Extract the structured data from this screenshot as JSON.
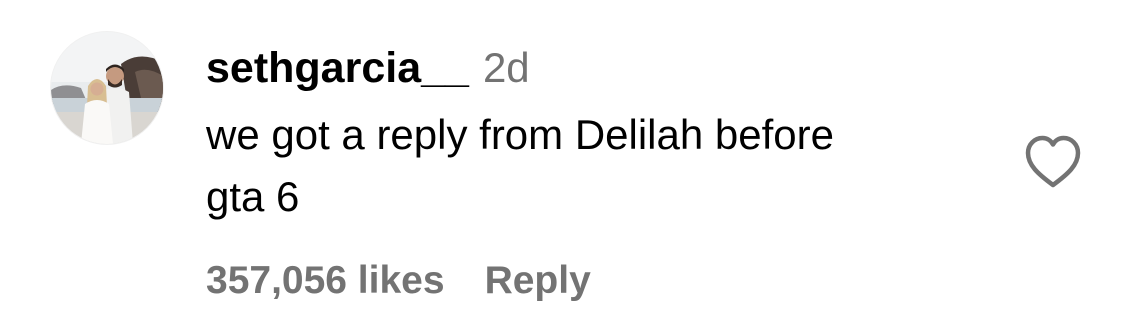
{
  "comment": {
    "username": "sethgarcia__",
    "timestamp": "2d",
    "text": "we got a reply from Delilah before\ngta 6",
    "likes_label": "357,056 likes",
    "reply_label": "Reply"
  },
  "icons": {
    "avatar": "profile-photo-avatar",
    "like": "heart-outline-icon"
  },
  "colors": {
    "text": "#000000",
    "secondary": "#737373",
    "icon": "#737373"
  }
}
